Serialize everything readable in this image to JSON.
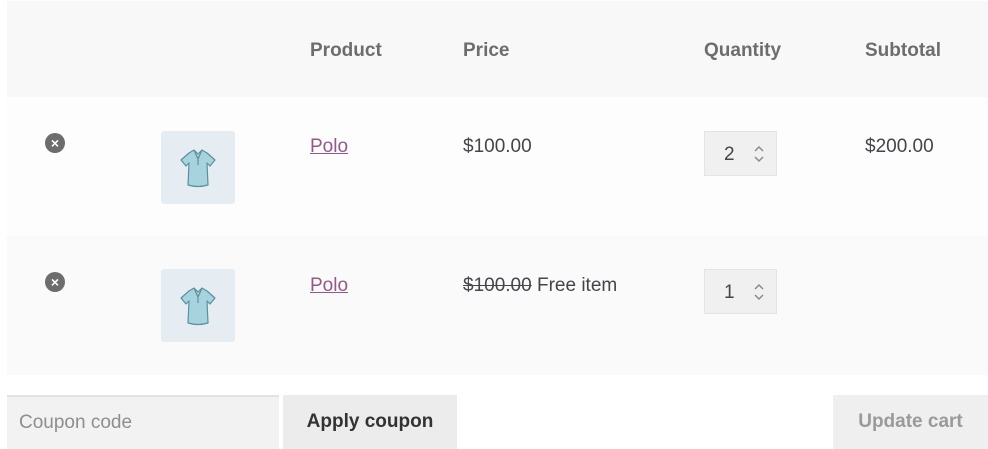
{
  "headers": {
    "product": "Product",
    "price": "Price",
    "quantity": "Quantity",
    "subtotal": "Subtotal"
  },
  "rows": [
    {
      "remove_icon": "×",
      "thumbnail_icon": "polo-shirt-icon",
      "product": "Polo",
      "price": "$100.00",
      "price_original": "",
      "price_note": "",
      "quantity": "2",
      "subtotal": "$200.00"
    },
    {
      "remove_icon": "×",
      "thumbnail_icon": "polo-shirt-icon",
      "product": "Polo",
      "price": "",
      "price_original": "$100.00",
      "price_note": "Free item",
      "quantity": "1",
      "subtotal": ""
    }
  ],
  "actions": {
    "coupon_placeholder": "Coupon code",
    "apply_label": "Apply coupon",
    "update_label": "Update cart"
  },
  "colors": {
    "link": "#96588a",
    "text": "#43454b",
    "header_bg": "#f8f8f8"
  }
}
